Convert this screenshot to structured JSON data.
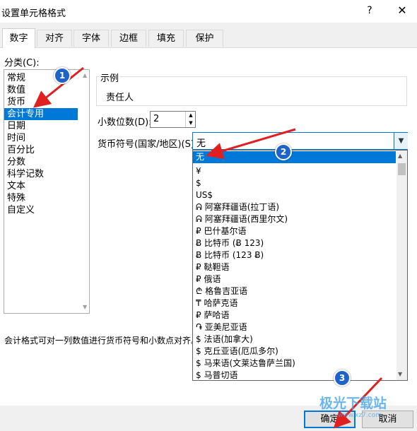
{
  "window": {
    "title": "设置单元格格式",
    "help_glyph": "?",
    "close_glyph": "✕"
  },
  "tabs": [
    {
      "label": "数字",
      "active": true
    },
    {
      "label": "对齐"
    },
    {
      "label": "字体"
    },
    {
      "label": "边框"
    },
    {
      "label": "填充"
    },
    {
      "label": "保护"
    }
  ],
  "category": {
    "label": "分类(C):",
    "items": [
      "常规",
      "数值",
      "货币",
      "会计专用",
      "日期",
      "时间",
      "百分比",
      "分数",
      "科学记数",
      "文本",
      "特殊",
      "自定义"
    ],
    "selected_index": 3
  },
  "sample": {
    "label": "示例",
    "value": "责任人"
  },
  "decimal": {
    "label": "小数位数(D):",
    "value": "2"
  },
  "currency": {
    "label": "货币符号(国家/地区)(S):",
    "value": "无",
    "options": [
      "无",
      "¥",
      "$",
      "US$",
      "ᕱ 阿塞拜疆语(拉丁语)",
      "ᕱ 阿塞拜疆语(西里尔文)",
      "₽ 巴什基尔语",
      "Ƀ 比特币 (Ƀ 123)",
      "Ƀ 比特币 (123 Ƀ)",
      "₽ 鞑靼语",
      "₽ 俄语",
      "₾ 格鲁吉亚语",
      "₸ 哈萨克语",
      "₽ 萨哈语",
      "֏ 亚美尼亚语",
      "$ 法语(加拿大)",
      "$ 克丘亚语(厄瓜多尔)",
      "$ 马来语(文莱达鲁萨兰国)",
      "$ 马普切语"
    ],
    "selected_index": 0
  },
  "description": "会计格式可对一列数值进行货币符号和小数点对齐。",
  "buttons": {
    "ok": "确定",
    "cancel": "取消"
  },
  "annotations": [
    {
      "number": "1"
    },
    {
      "number": "2"
    },
    {
      "number": "3"
    }
  ],
  "watermark": {
    "text": "极光下载站",
    "sub": "www.xz7.com"
  },
  "colors": {
    "accent": "#0078d7",
    "badge": "#1e63c9",
    "arrow": "#e02020"
  }
}
